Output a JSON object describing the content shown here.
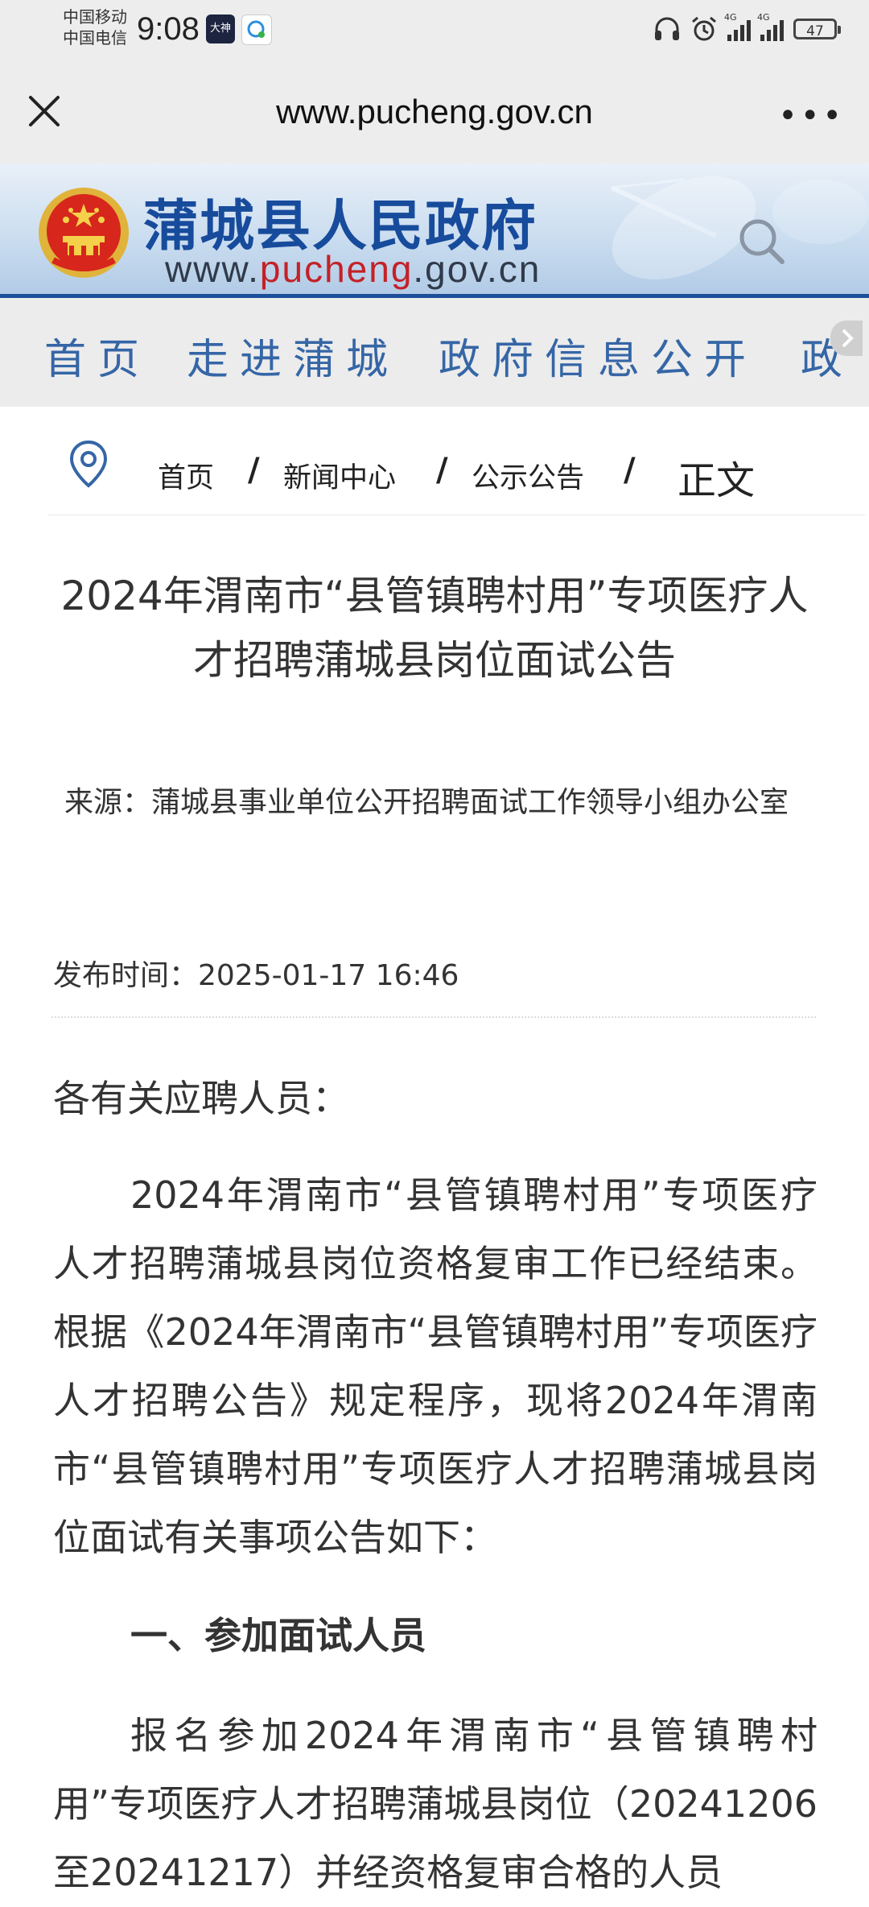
{
  "status_bar": {
    "carrier1": "中国移动",
    "carrier2": "中国电信",
    "time": "9:08",
    "app1_label": "大神",
    "network1": "4G",
    "network2": "4G",
    "battery": "47"
  },
  "browser": {
    "url": "www.pucheng.gov.cn",
    "more_label": "•••"
  },
  "banner": {
    "title": "蒲城县人民政府",
    "domain_pre": "www.",
    "domain_hl": "pucheng",
    "domain_post": ".gov.cn"
  },
  "nav": {
    "items": [
      "首页",
      "走进蒲城",
      "政府信息公开",
      "政"
    ]
  },
  "breadcrumb": {
    "items": [
      "首页",
      "新闻中心",
      "公示公告"
    ],
    "sep": "/",
    "current": "正文"
  },
  "article": {
    "title": "2024年渭南市“县管镇聘村用”专项医疗人才招聘蒲城县岗位面试公告",
    "source": "来源：蒲城县事业单位公开招聘面试工作领导小组办公室",
    "publish_time": "发布时间：2025-01-17 16:46",
    "greeting": "各有关应聘人员：",
    "paragraph1": "2024年渭南市“县管镇聘村用”专项医疗人才招聘蒲城县岗位资格复审工作已经结束。根据《2024年渭南市“县管镇聘村用”专项医疗人才招聘公告》规定程序，现将2024年渭南市“县管镇聘村用”专项医疗人才招聘蒲城县岗位面试有关事项公告如下：",
    "section1": "一、参加面试人员",
    "paragraph2": "报名参加2024年渭南市“县管镇聘村用”专项医疗人才招聘蒲城县岗位（20241206至20241217）并经资格复审合格的人员"
  },
  "colors": {
    "nav_text": "#3566a6",
    "title_blue": "#174b9c",
    "accent_red": "#c42127"
  }
}
